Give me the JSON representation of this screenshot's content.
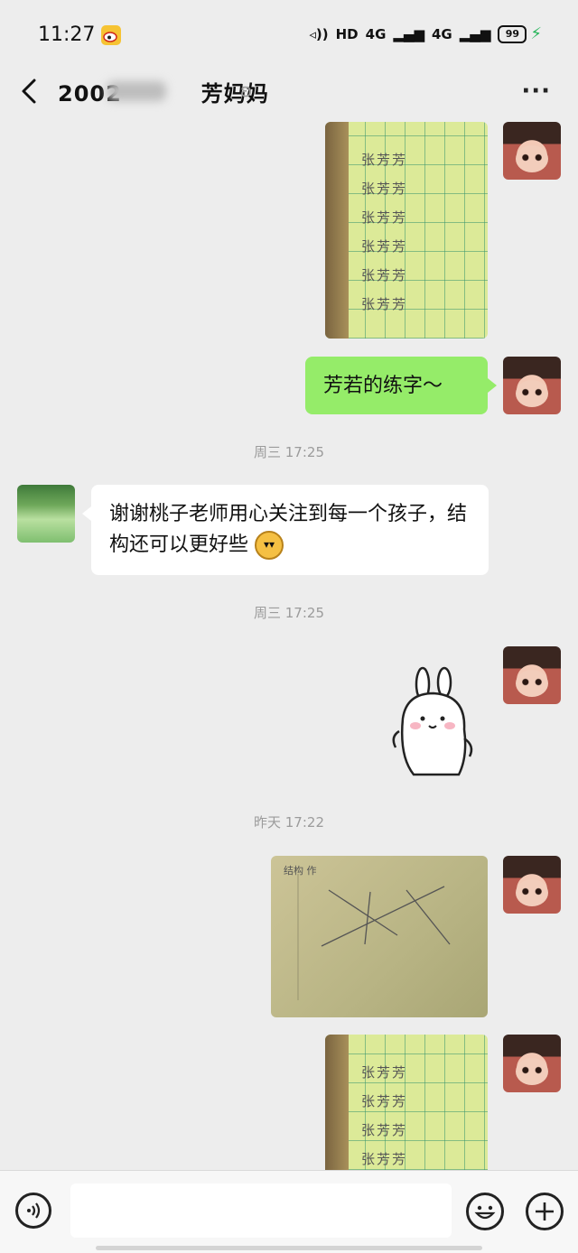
{
  "status_bar": {
    "time": "11:27",
    "signal_text": "HD",
    "net1": "4G",
    "net2": "4G",
    "battery": "99",
    "icons": [
      "weibo-icon",
      "mute-vibrate-icon",
      "signal-icon",
      "battery-icon",
      "charging-icon"
    ]
  },
  "header": {
    "back_icon": "chevron-left-icon",
    "title": "2002",
    "title_suffix": "芳妈妈",
    "ear_icon": "ear-icon",
    "more_label": "···"
  },
  "messages": {
    "bubble1_text": "芳若的练字～",
    "time1": "周三 17:25",
    "bubble2_text": "谢谢桃子老师用心关注到每一个孩子，结构还可以更好些",
    "bubble2_emoji": "grin-emoji",
    "time2": "周三 17:25",
    "time3": "昨天 17:22",
    "practice_chars": "张芳芳\n张芳芳\n张芳芳\n张芳芳\n张芳芳\n张芳芳",
    "lines_caption": "结构 作"
  },
  "input_bar": {
    "placeholder": "",
    "icons": [
      "voice-icon",
      "emoji-icon",
      "add-icon"
    ]
  },
  "colors": {
    "background": "#ededed",
    "green_bubble": "#95ec69",
    "white_bubble": "#ffffff",
    "timestamp": "#9b9b9b"
  }
}
